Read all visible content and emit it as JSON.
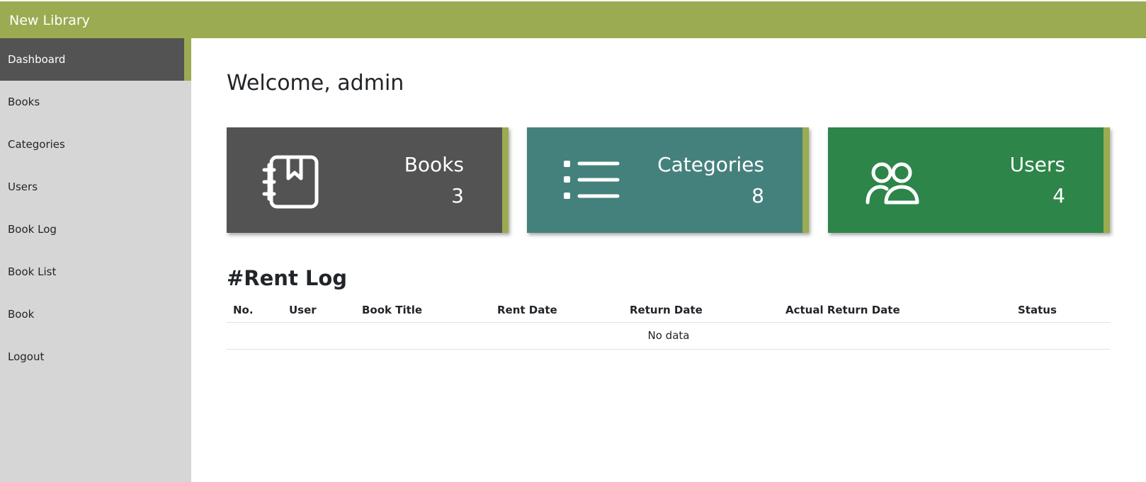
{
  "app": {
    "title": "New Library"
  },
  "sidebar": {
    "items": [
      {
        "label": "Dashboard",
        "active": true
      },
      {
        "label": "Books"
      },
      {
        "label": "Categories"
      },
      {
        "label": "Users"
      },
      {
        "label": "Book Log"
      },
      {
        "label": "Book List"
      },
      {
        "label": "Book"
      },
      {
        "label": "Logout"
      }
    ]
  },
  "main": {
    "welcome": "Welcome, admin",
    "cards": [
      {
        "title": "Books",
        "value": "3",
        "icon": "book-icon",
        "color": "#535353"
      },
      {
        "title": "Categories",
        "value": "8",
        "icon": "list-icon",
        "color": "#45817c"
      },
      {
        "title": "Users",
        "value": "4",
        "icon": "users-icon",
        "color": "#2d8549"
      }
    ],
    "rent_log": {
      "title": "#Rent Log",
      "columns": [
        "No.",
        "User",
        "Book Title",
        "Rent Date",
        "Return Date",
        "Actual Return Date",
        "Status"
      ],
      "empty_text": "No data"
    }
  },
  "colors": {
    "accent": "#9aab52",
    "sidebar": "#d6d6d6",
    "active": "#535353"
  }
}
